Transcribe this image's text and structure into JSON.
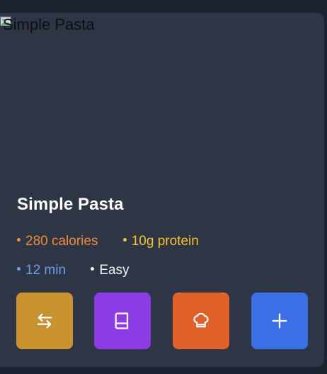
{
  "card": {
    "image_alt": "Simple Pasta",
    "title": "Simple Pasta",
    "calories": "280 calories",
    "protein": "10g protein",
    "time": "12 min",
    "difficulty": "Easy"
  },
  "colors": {
    "calories": "#ef8a3c",
    "protein": "#f2c230",
    "time": "#6e9ee8",
    "difficulty": "#f3f4f6",
    "swap_button": "#c8922e",
    "recipe_button": "#8c3be6",
    "cook_button": "#e0622a",
    "add_button": "#3b6fe6"
  },
  "actions": [
    {
      "icon": "swap-arrows-icon"
    },
    {
      "icon": "book-icon"
    },
    {
      "icon": "chef-hat-icon"
    },
    {
      "icon": "plus-icon"
    }
  ]
}
